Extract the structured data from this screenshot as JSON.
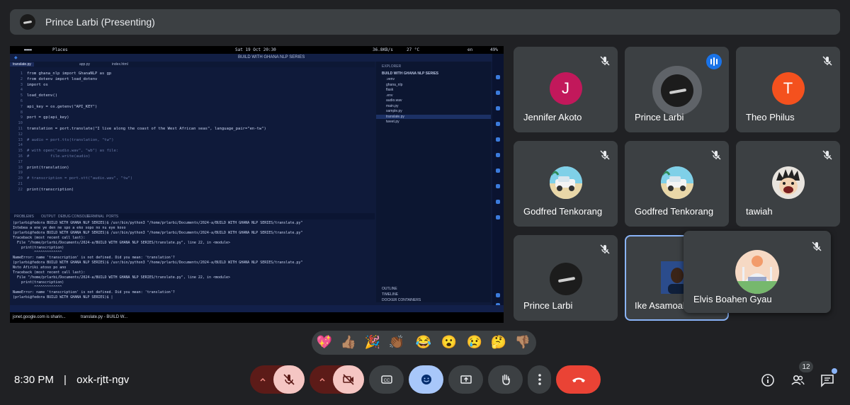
{
  "presenter_bar": {
    "title": "Prince Larbi (Presenting)"
  },
  "shared_screen": {
    "os_bar": {
      "left": "Places",
      "center": "Sat 19 Oct 20:30",
      "net": "36.8KB/s",
      "temp": "27 °C",
      "lang": "en",
      "battery": "49%"
    },
    "window_title": "BUILD WITH GHANA NLP SERIES",
    "tabs": [
      "translate.py",
      "app.py",
      "index.html"
    ],
    "code_lines": [
      "from ghana_nlp import GhanaNLP as gp",
      "from dotenv import load_dotenv",
      "import os",
      "",
      "load_dotenv()",
      "",
      "api_key = os.getenv(\"API_KEY\")",
      "",
      "port = gp(api_key)",
      "",
      "translation = port.translate(\"I live along the coast of the West African seas\", language_pair=\"en-tw\")",
      "",
      "# audio = port.tts(translation, \"tw\")",
      "",
      "# with open(\"audio.wav\", \"wb\") as file:",
      "#         file.write(audio)",
      "",
      "print(translation)",
      "",
      "# transcription = port.stt(\"audio.wav\", \"tw\")",
      "",
      "print(transcription)"
    ],
    "explorer": {
      "header": "EXPLORER",
      "project": "BUILD WITH GHANA NLP SERIES",
      "items": [
        ".venv",
        "ghana_nlp",
        "flask",
        ".env",
        "audio.wav",
        "main.py",
        "sample.py",
        "translate.py",
        "tweet.py"
      ],
      "bottom": [
        "OUTLINE",
        "TIMELINE",
        "DOCKER CONTAINERS"
      ]
    },
    "panel_tabs": [
      "PROBLEMS",
      "OUTPUT",
      "DEBUG CONSOLE",
      "TERMINAL",
      "PORTS"
    ],
    "terminal_lines": [
      "(prlarbi@fedora BUILD WITH GHANA NLP SERIES)$ /usr/bin/python3 \"/home/prlarbi/Documents/2024-a/BUILD WITH GHANA NLP SERIES/translate.py\"",
      "Intebea a ene ye den ne spo a eko sopo no nu eye koso",
      "(prlarbi@fedora BUILD WITH GHANA NLP SERIES)$ /usr/bin/python3 \"/home/prlarbi/Documents/2024-a/BUILD WITH GHANA NLP SERIES/translate.py\"",
      "Traceback (most recent call last):",
      "  File \"/home/prlarbi/Documents/2024-a/BUILD WITH GHANA NLP SERIES/translate.py\", line 22, in <module>",
      "    print(transcription)",
      "          ^^^^^^^^^^^^^",
      "NameError: name 'transcription' is not defined. Did you mean: 'translation'?",
      "(prlarbi@fedora BUILD WITH GHANA NLP SERIES)$ /usr/bin/python3 \"/home/prlarbi/Documents/2024-a/BUILD WITH GHANA NLP SERIES/translate.py\"",
      "Nsto Afiriki atoso po ano",
      "Traceback (most recent call last):",
      "  File \"/home/prlarbi/Documents/2024-a/BUILD WITH GHANA NLP SERIES/translate.py\", line 22, in <module>",
      "    print(transcription)",
      "          ^^^^^^^^^^^^^",
      "NameError: name 'transcription' is not defined. Did you mean: 'translation'?",
      "(prlarbi@fedora BUILD WITH GHANA NLP SERIES)$ |"
    ],
    "taskbar": {
      "sharing": "jonet.google.com is sharin...",
      "app": "translate.py - BUILD W..."
    }
  },
  "tiles": [
    {
      "name": "Jennifer Akoto",
      "initial": "J",
      "color": "#c2185b"
    },
    {
      "name": "Prince Larbi"
    },
    {
      "name": "Theo Philus",
      "initial": "T",
      "color": "#f4511e"
    },
    {
      "name": "Godfred Tenkorang"
    },
    {
      "name": "Godfred Tenkorang"
    },
    {
      "name": "tawiah"
    },
    {
      "name": "Prince Larbi"
    },
    {
      "name": "Ike Asamoah"
    }
  ],
  "floating_tile": {
    "name": "Elvis Boahen Gyau"
  },
  "reactions": [
    "💖",
    "👍🏽",
    "🎉",
    "👏🏾",
    "😂",
    "😮",
    "😢",
    "🤔",
    "👎🏽"
  ],
  "bottom_bar": {
    "time": "8:30 PM",
    "separator": "|",
    "meeting_code": "oxk-rjtt-ngv",
    "participants_count": "12"
  },
  "icons": [
    "mic-off-icon",
    "video-off-icon",
    "captions-icon",
    "emoji-icon",
    "present-icon",
    "raise-hand-icon",
    "more-icon",
    "end-call-icon",
    "info-icon",
    "people-icon",
    "chat-icon"
  ]
}
